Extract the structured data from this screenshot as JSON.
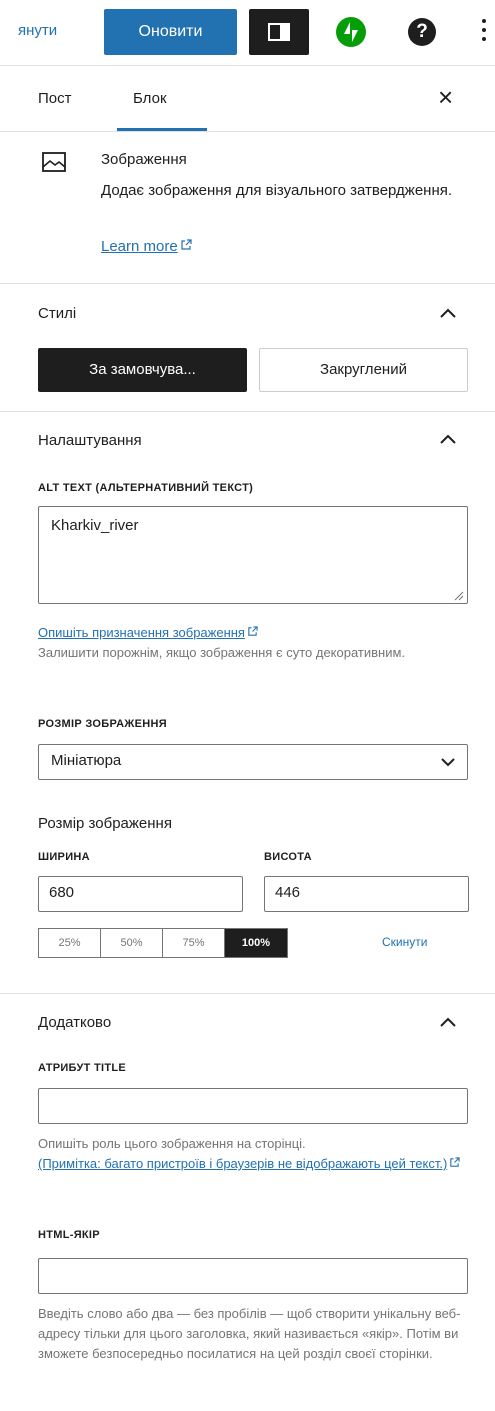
{
  "toolbar": {
    "revert_label": "янути",
    "update_label": "Оновити",
    "help_label": "?"
  },
  "tabs": {
    "post": "Пост",
    "block": "Блок",
    "close": "×"
  },
  "block_card": {
    "title": "Зображення",
    "description": "Додає зображення для візуального затвердження.",
    "learn_more": "Learn more"
  },
  "styles": {
    "title": "Стилі",
    "default_label": "За замовчува...",
    "rounded_label": "Закруглений"
  },
  "settings": {
    "title": "Налаштування",
    "alt_label": "ALT TEXT (АЛЬТЕРНАТИВНИЙ ТЕКСТ)",
    "alt_value": "Kharkiv_river",
    "alt_link": "Опишіть призначення зображення",
    "alt_help": "Залишити порожнім, якщо зображення є суто декоративним.",
    "size_label": "РОЗМІР ЗОБРАЖЕННЯ",
    "size_value": "Мініатюра",
    "dims_heading": "Розмір зображення",
    "width_label": "ШИРИНА",
    "height_label": "ВИСОТА",
    "width_value": "680",
    "height_value": "446",
    "percent_options": [
      "25%",
      "50%",
      "75%",
      "100%"
    ],
    "active_percent": "100%",
    "reset_label": "Скинути"
  },
  "advanced": {
    "title": "Додатково",
    "title_attr_label": "АТРИБУТ TITLE",
    "title_attr_value": "",
    "title_help": "Опишіть роль цього зображення на сторінці.",
    "title_note_link": "(Примітка: багато пристроїв і браузерів не відображають цей текст.)",
    "anchor_label": "HTML-ЯКІР",
    "anchor_value": "",
    "anchor_help": "Введіть слово або два — без пробілів — щоб створити унікальну веб-адресу тільки для цього заголовка, який називається «якір». Потім ви зможете безпосередньо посилатися на цей розділ своєї сторінки."
  },
  "colors": {
    "accent": "#2271b1",
    "dark": "#1e1e1e",
    "jetpack": "#069e08",
    "muted": "#757575"
  },
  "icons": [
    "sidebar-toggle-icon",
    "jetpack-icon",
    "help-icon",
    "more-vertical-icon",
    "close-icon",
    "image-icon",
    "external-link-icon",
    "chevron-up-icon",
    "chevron-down-icon",
    "resize-grip-icon"
  ]
}
